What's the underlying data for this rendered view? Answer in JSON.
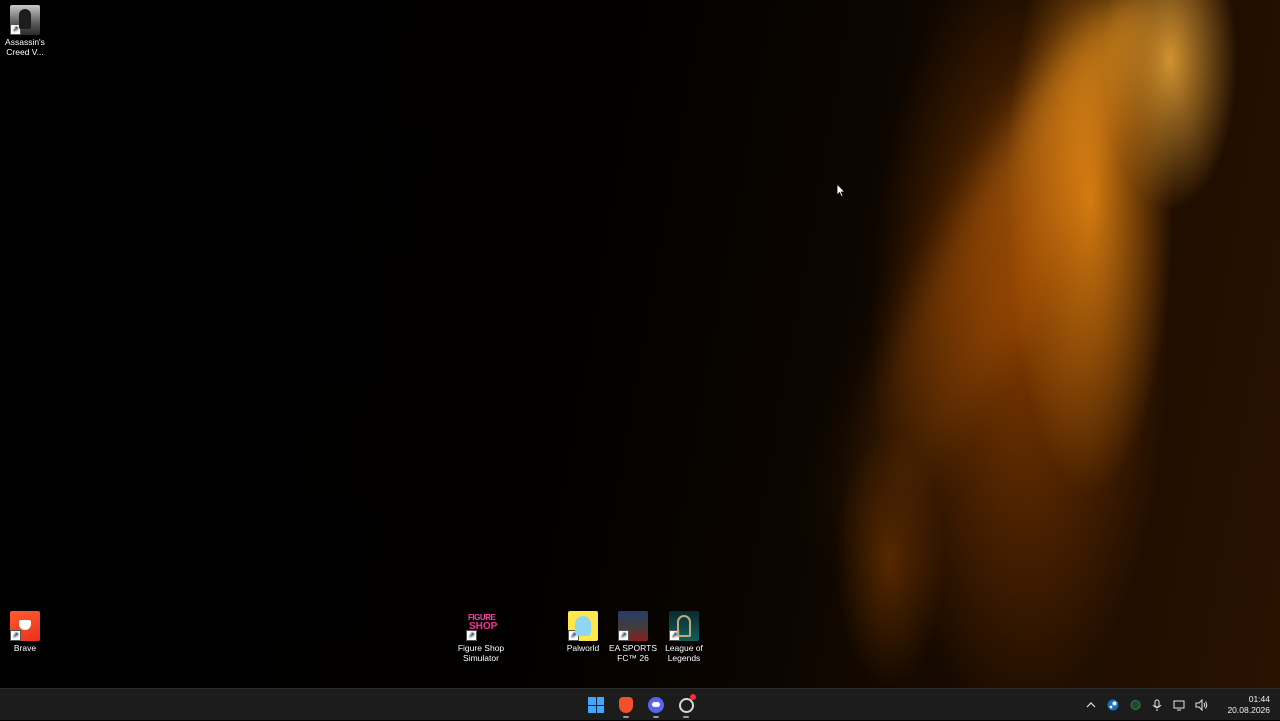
{
  "desktop": {
    "icons": [
      {
        "label": "Assassin's\nCreed V...",
        "icon": "assassins-creed-icon"
      },
      {
        "label": "Brave",
        "icon": "brave-icon"
      },
      {
        "label": "Figure Shop\nSimulator",
        "icon": "figure-shop-simulator-icon",
        "logo_text_1": "FIGURE",
        "logo_text_2": "SHOP"
      },
      {
        "label": "Palworld",
        "icon": "palworld-icon"
      },
      {
        "label": "EA SPORTS\nFC™ 26",
        "icon": "ea-sports-fc-icon"
      },
      {
        "label": "League of\nLegends",
        "icon": "league-of-legends-icon"
      }
    ]
  },
  "taskbar": {
    "pinned": [
      {
        "name": "Start",
        "icon": "windows-start-icon"
      },
      {
        "name": "Brave",
        "icon": "brave-icon"
      },
      {
        "name": "Discord",
        "icon": "discord-icon"
      },
      {
        "name": "App with notification",
        "icon": "app-notification-icon"
      }
    ],
    "tray": {
      "icons": [
        "chevron-up-icon",
        "steam-icon",
        "shield-icon",
        "microphone-icon",
        "display-icon",
        "speaker-icon"
      ],
      "time": "01:44",
      "date": "20.08.2026"
    }
  },
  "colors": {
    "accent_windows": "#3fa7ff",
    "wallpaper_glow": "#ff9a1f",
    "taskbar_bg": "#1c1c1c"
  }
}
